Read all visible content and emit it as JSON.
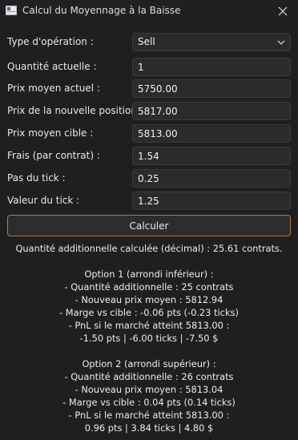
{
  "window": {
    "title": "Calcul du Moyennage à la Baisse",
    "app_icon": "window-app-icon",
    "close_icon": "close-icon"
  },
  "form": {
    "operation_type": {
      "label": "Type d'opération :",
      "value": "Sell"
    },
    "current_quantity": {
      "label": "Quantité actuelle :",
      "value": "1"
    },
    "current_avg_price": {
      "label": "Prix moyen actuel :",
      "value": "5750.00"
    },
    "new_position_price": {
      "label": "Prix de la nouvelle position :",
      "value": "5817.00"
    },
    "target_avg_price": {
      "label": "Prix moyen cible :",
      "value": "5813.00"
    },
    "fees": {
      "label": "Frais (par contrat) :",
      "value": "1.54"
    },
    "tick_size": {
      "label": "Pas du tick :",
      "value": "0.25"
    },
    "tick_value": {
      "label": "Valeur du tick :",
      "value": "1.25"
    }
  },
  "compute_button": "Calculer",
  "results": {
    "summary": "Quantité additionnelle calculée (décimal) : 25.61 contrats.",
    "option1": {
      "title": "Option 1 (arrondi inférieur) :",
      "quantity": "- Quantité additionnelle : 25 contrats",
      "new_avg": "- Nouveau prix moyen : 5812.94",
      "margin": "- Marge vs cible : -0.06 pts (-0.23 ticks)",
      "pnl_label": "- PnL si le marché atteint 5813.00 :",
      "pnl_values": "-1.50 pts | -6.00 ticks | -7.50 $"
    },
    "option2": {
      "title": "Option 2 (arrondi supérieur) :",
      "quantity": "- Quantité additionnelle : 26 contrats",
      "new_avg": "- Nouveau prix moyen : 5813.04",
      "margin": "- Marge vs cible : 0.04 pts (0.14 ticks)",
      "pnl_label": "- PnL si le marché atteint 5813.00 :",
      "pnl_values": "0.96 pts | 3.84 ticks | 4.80 $"
    }
  }
}
